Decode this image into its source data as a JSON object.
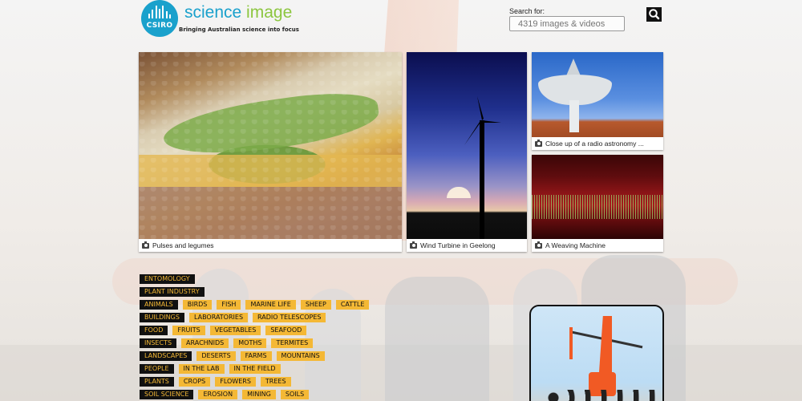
{
  "header": {
    "logo_text": "CSIRO",
    "brand_science": "science",
    "brand_image": "image",
    "tagline": "Bringing Australian science into focus",
    "search_label": "Search for:",
    "search_placeholder": "4319 images & videos"
  },
  "tiles": [
    {
      "caption": "Pulses and legumes"
    },
    {
      "caption": "Wind Turbine in Geelong"
    },
    {
      "caption": "Close up of a radio astronomy ..."
    },
    {
      "caption": "A Weaving Machine"
    }
  ],
  "tag_rows": [
    {
      "category": "ENTOMOLOGY",
      "items": []
    },
    {
      "category": "PLANT INDUSTRY",
      "items": []
    },
    {
      "category": "ANIMALS",
      "items": [
        "BIRDS",
        "FISH",
        "MARINE LIFE",
        "SHEEP",
        "CATTLE"
      ]
    },
    {
      "category": "BUILDINGS",
      "items": [
        "LABORATORIES",
        "RADIO TELESCOPES"
      ]
    },
    {
      "category": "FOOD",
      "items": [
        "FRUITS",
        "VEGETABLES",
        "SEAFOOD"
      ]
    },
    {
      "category": "INSECTS",
      "items": [
        "ARACHNIDS",
        "MOTHS",
        "TERMITES"
      ]
    },
    {
      "category": "LANDSCAPES",
      "items": [
        "DESERTS",
        "FARMS",
        "MOUNTAINS"
      ]
    },
    {
      "category": "PEOPLE",
      "items": [
        "IN THE LAB",
        "IN THE FIELD"
      ]
    },
    {
      "category": "PLANTS",
      "items": [
        "CROPS",
        "FLOWERS",
        "TREES"
      ]
    },
    {
      "category": "SOIL SCIENCE",
      "items": [
        "EROSION",
        "MINING",
        "SOILS"
      ]
    }
  ],
  "colors": {
    "brand_blue": "#1aa1cc",
    "brand_green": "#8cc63f",
    "tag_yellow": "#f4b835",
    "tag_black": "#111111"
  },
  "icons": {
    "search": "search-icon",
    "camera": "camera-icon"
  }
}
